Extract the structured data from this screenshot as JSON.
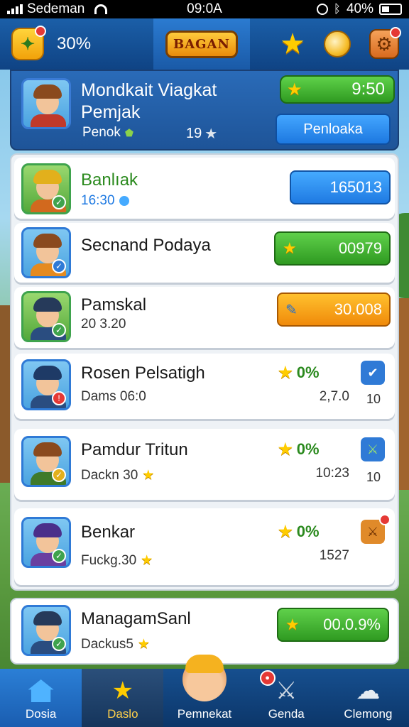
{
  "status_bar": {
    "carrier": "Sedeman",
    "time": "09:0A",
    "battery": "40%"
  },
  "top_bar": {
    "percent": "30%",
    "logo_text": "BAGAN"
  },
  "profile": {
    "name": "Mondkait Viagkat Pemjak",
    "rank_label": "Penok",
    "level": "19",
    "score": "9:50",
    "action_label": "Penloaka"
  },
  "rows": [
    {
      "name": "Banlıak",
      "sub": "16:30",
      "button": "165013",
      "button_style": "blue"
    },
    {
      "name": "Secnand Podaya",
      "button": "00979",
      "button_style": "green"
    },
    {
      "name": "Pamskal",
      "sub": "20 3.20",
      "button": "30.008",
      "button_style": "orange"
    },
    {
      "name": "Rosen Pelsatigh",
      "sub": "Dams 06:0",
      "pct": "0%",
      "value": "2,7.0",
      "side_num": "10"
    },
    {
      "name": "Pamdur Tritun",
      "sub": "Dackn 30",
      "pct": "0%",
      "value": "10:23",
      "side_num": "10"
    },
    {
      "name": "Benkar",
      "sub": "Fuckg.30",
      "pct": "0%",
      "value": "1527"
    },
    {
      "name": "ManagamSanl",
      "sub": "Dackus5",
      "button": "00.0.9%",
      "button_style": "green"
    }
  ],
  "nav": [
    {
      "label": "Dosia"
    },
    {
      "label": "Daslo"
    },
    {
      "label": "Pemnekat"
    },
    {
      "label": "Genda"
    },
    {
      "label": "Clemong"
    }
  ],
  "colors": {
    "primary_blue": "#1b5fa8",
    "green_button": "#2f9a21",
    "orange_button": "#f08a0a",
    "star_gold": "#ffcc00"
  }
}
